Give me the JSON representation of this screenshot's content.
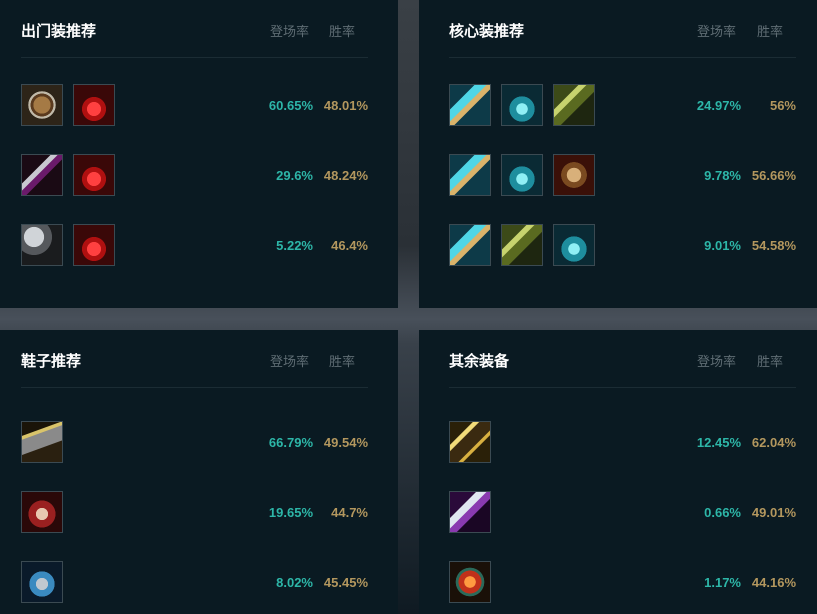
{
  "headers": {
    "pick_rate": "登场率",
    "win_rate": "胜率"
  },
  "panels": {
    "starter": {
      "title": "出门装推荐",
      "rows": [
        {
          "icons": [
            "shield-icon",
            "health-potion-icon"
          ],
          "pick": "60.65%",
          "win": "48.01%"
        },
        {
          "icons": [
            "dagger-sword-icon",
            "health-potion-icon"
          ],
          "pick": "29.6%",
          "win": "48.24%"
        },
        {
          "icons": [
            "scythe-icon",
            "health-potion-icon"
          ],
          "pick": "5.22%",
          "win": "46.4%"
        }
      ]
    },
    "core": {
      "title": "核心装推荐",
      "rows": [
        {
          "icons": [
            "cyan-bow-icon",
            "ice-bow-icon",
            "crossbow-icon"
          ],
          "pick": "24.97%",
          "win": "56%"
        },
        {
          "icons": [
            "cyan-bow-icon",
            "ice-bow-icon",
            "gauntlet-icon"
          ],
          "pick": "9.78%",
          "win": "56.66%"
        },
        {
          "icons": [
            "cyan-bow-icon",
            "crossbow-icon",
            "ice-bow-icon"
          ],
          "pick": "9.01%",
          "win": "54.58%"
        }
      ]
    },
    "boots": {
      "title": "鞋子推荐",
      "rows": [
        {
          "icons": [
            "lightning-boots-icon"
          ],
          "pick": "66.79%",
          "win": "49.54%"
        },
        {
          "icons": [
            "red-boots-icon"
          ],
          "pick": "19.65%",
          "win": "44.7%"
        },
        {
          "icons": [
            "steel-boots-icon"
          ],
          "pick": "8.02%",
          "win": "45.45%"
        }
      ]
    },
    "other": {
      "title": "其余装备",
      "rows": [
        {
          "icons": [
            "golden-dagger-icon"
          ],
          "pick": "12.45%",
          "win": "62.04%"
        },
        {
          "icons": [
            "spear-icon"
          ],
          "pick": "0.66%",
          "win": "49.01%"
        },
        {
          "icons": [
            "crimson-orb-icon"
          ],
          "pick": "1.17%",
          "win": "44.16%"
        }
      ]
    }
  }
}
